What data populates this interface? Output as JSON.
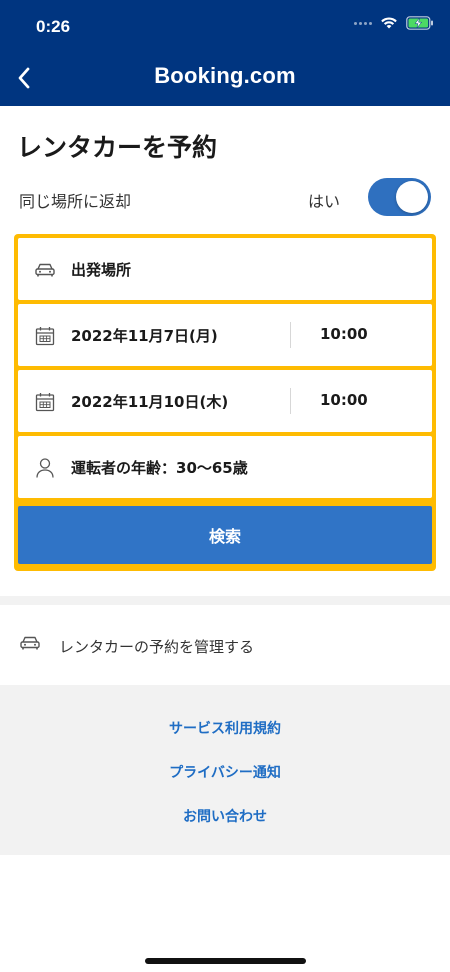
{
  "status_bar": {
    "time": "0:26"
  },
  "header": {
    "brand": "Booking.com"
  },
  "page": {
    "title": "レンタカーを予約",
    "same_location_label": "同じ場所に返却",
    "same_location_value": "はい"
  },
  "form": {
    "pickup_label": "出発場所",
    "pickup_date": "2022年11月7日(月)",
    "pickup_time": "10:00",
    "dropoff_date": "2022年11月10日(木)",
    "dropoff_time": "10:00",
    "driver_age": "運転者の年齢：30〜65歳",
    "search_label": "検索"
  },
  "manage": {
    "label": "レンタカーの予約を管理する"
  },
  "footer": {
    "terms": "サービス利用規約",
    "privacy": "プライバシー通知",
    "contact": "お問い合わせ"
  },
  "colors": {
    "header": "#003580",
    "accent": "#febb02",
    "button": "#3074c6",
    "link": "#1f6dc4"
  }
}
